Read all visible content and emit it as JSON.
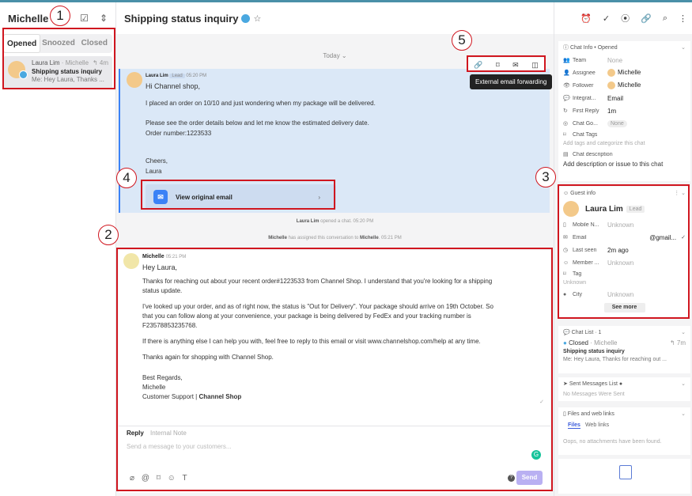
{
  "left": {
    "title": "Michelle",
    "tabs": [
      "Opened",
      "Snoozed",
      "Closed"
    ],
    "conversation": {
      "name": "Laura Lim",
      "assignee": " · Michelle",
      "time": "4m",
      "subject": "Shipping status inquiry",
      "preview": "Me: Hey Laura, Thanks ..."
    }
  },
  "center": {
    "title": "Shipping status inquiry",
    "today_label": "Today",
    "tooltip": "External email forwarding",
    "email": {
      "sender": "Laura Lim",
      "badge": "Lead",
      "time": "05:20 PM",
      "greeting": "Hi Channel shop,",
      "p1": "I placed an order on 10/10 and just wondering when my package will be delivered.",
      "p2": "Please see the order details below and let me know the estimated delivery date.",
      "p3": "Order number:1223533",
      "sign1": "Cheers,",
      "sign2": "Laura",
      "view_label": "View original email"
    },
    "system1": {
      "name": "Laura Lim",
      "text": " opened a chat.",
      "time": " 05:20 PM"
    },
    "system2": {
      "name": "Michelle",
      "text": " has assigned this conversation to ",
      "target": "Michelle",
      "time": ". 05:21 PM"
    },
    "reply": {
      "sender": "Michelle",
      "time": "05:21 PM",
      "greeting": "Hey Laura,",
      "p1": "Thanks for reaching out about your recent order#1223533 from Channel Shop. I understand that you're looking for a shipping status update.",
      "p2": "I've looked up your order, and as of right now, the status is \"Out for Delivery\". Your package should arrive on 19th October. So that you can follow along at your convenience, your package is being delivered by FedEx and your tracking number is F23578853235768.",
      "p3": "If there is anything else I can help you with, feel free to reply to this email or visit www.channelshop.com/help at any time.",
      "p4": "Thanks again for shopping with Channel Shop.",
      "sign1": "Best Regards,",
      "sign2": "Michelle",
      "sign3": "Customer Support | ",
      "sign3b": "Channel Shop"
    },
    "composer": {
      "tab_reply": "Reply",
      "tab_note": "Internal Note",
      "placeholder": "Send a message to your customers...",
      "send": "Send"
    }
  },
  "right": {
    "chat_info": {
      "title": "Chat Info • Opened",
      "team_label": "Team",
      "team_value": "None",
      "assignee_label": "Assignee",
      "assignee_value": "Michelle",
      "follower_label": "Follower",
      "follower_value": "Michelle",
      "integration_label": "Integrat...",
      "integration_value": "Email",
      "first_reply_label": "First Reply",
      "first_reply_value": "1m",
      "chat_goal_label": "Chat Go...",
      "chat_goal_value": "None",
      "tags_label": "Chat Tags",
      "tags_placeholder": "Add tags and categorize this chat",
      "desc_label": "Chat description",
      "desc_placeholder": "Add description or issue to this chat"
    },
    "guest": {
      "title": "Guest info",
      "name": "Laura Lim",
      "badge": "Lead",
      "mobile_label": "Mobile N...",
      "mobile_value": "Unknown",
      "email_label": "Email",
      "email_value": "@gmail...",
      "last_seen_label": "Last seen",
      "last_seen_value": "2m ago",
      "member_label": "Member ...",
      "member_value": "Unknown",
      "tag_label": "Tag",
      "tag_value": "Unknown",
      "city_label": "City",
      "city_value": "Unknown",
      "see_more": "See more"
    },
    "chat_list": {
      "title": "Chat List · 1",
      "status": "Closed",
      "assignee": " · Michelle",
      "time": "7m",
      "subject": "Shipping status inquiry",
      "preview": "Me: Hey Laura, Thanks for reaching out ..."
    },
    "sent_messages": {
      "title": "Sent Messages List",
      "empty": "No Messages Were Sent"
    },
    "files": {
      "title": "Files and web links",
      "tab_files": "Files",
      "tab_links": "Web links",
      "empty": "Oops, no attachments have been found."
    }
  },
  "annotations": {
    "n1": "1",
    "n2": "2",
    "n3": "3",
    "n4": "4",
    "n5": "5"
  }
}
